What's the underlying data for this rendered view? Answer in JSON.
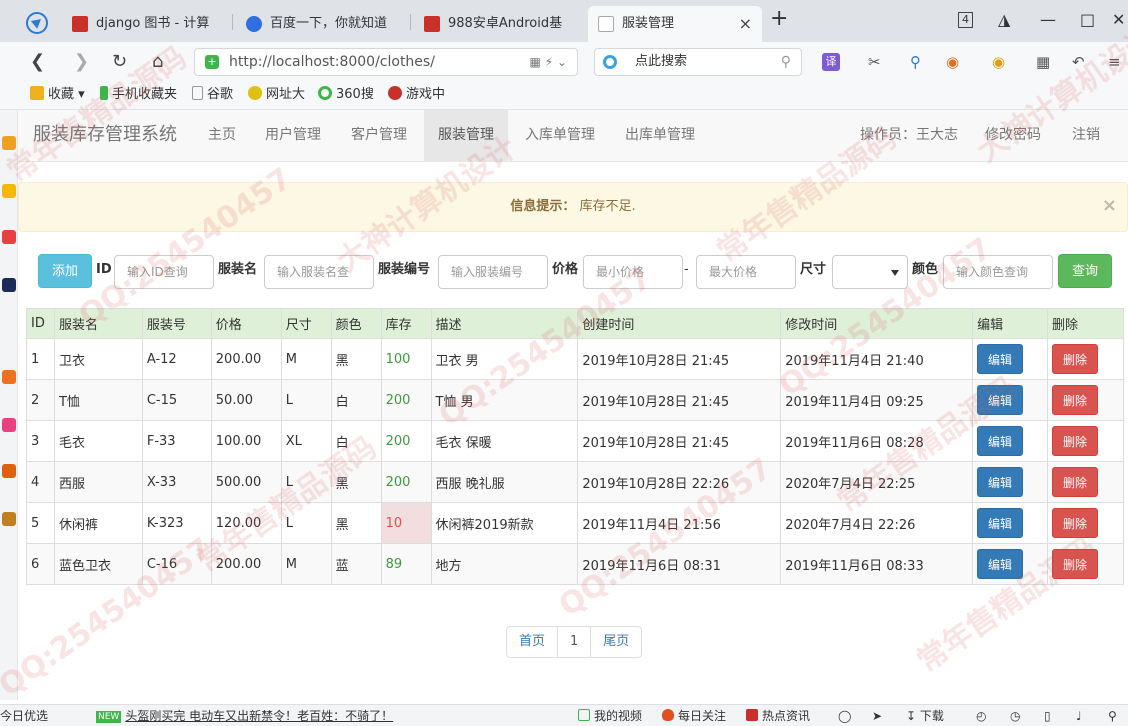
{
  "browser": {
    "tabs": [
      {
        "title": "django 图书 - 计算",
        "icon_color": "#c9302c"
      },
      {
        "title": "百度一下，你就知道",
        "icon_color": "#2f6fe0"
      },
      {
        "title": "988安卓Android基",
        "icon_color": "#c9302c"
      },
      {
        "title": "服装管理",
        "icon_color": "#dddddd",
        "close": "×"
      }
    ],
    "new_tab": "+",
    "tab_count": "4",
    "url": "http://localhost:8000/clothes/",
    "search_placeholder": "点此搜索",
    "bookmarks": [
      "收藏",
      "手机收藏夹",
      "谷歌",
      "网址大",
      "360搜",
      "游戏中"
    ]
  },
  "app": {
    "brand": "服装库存管理系统",
    "nav": [
      {
        "label": "主页",
        "active": false
      },
      {
        "label": "用户管理",
        "active": false
      },
      {
        "label": "客户管理",
        "active": false
      },
      {
        "label": "服装管理",
        "active": true
      },
      {
        "label": "入库单管理",
        "active": false
      },
      {
        "label": "出库单管理",
        "active": false
      }
    ],
    "operator": "操作员：王大志",
    "change_password": "修改密码",
    "logout": "注销"
  },
  "alert": {
    "title": "信息提示：",
    "message": "库存不足.",
    "close": "×"
  },
  "filter": {
    "add_label": "添加",
    "id_label": "ID",
    "id_placeholder": "输入ID查询",
    "name_label": "服装名",
    "name_placeholder": "输入服装名查",
    "code_label": "服装编号",
    "code_placeholder": "输入服装编号",
    "price_label": "价格",
    "min_price_placeholder": "最小价格",
    "dash": "-",
    "max_price_placeholder": "最大价格",
    "size_label": "尺寸",
    "color_label": "颜色",
    "color_placeholder": "输入颜色查询",
    "query_label": "查询"
  },
  "table": {
    "headers": [
      "ID",
      "服装名",
      "服装号",
      "价格",
      "尺寸",
      "颜色",
      "库存",
      "描述",
      "创建时间",
      "修改时间",
      "编辑",
      "删除"
    ],
    "edit_label": "编辑",
    "delete_label": "删除",
    "rows": [
      {
        "id": "1",
        "name": "卫衣",
        "code": "A-12",
        "price": "200.00",
        "size": "M",
        "color": "黑",
        "stock": "100",
        "low": false,
        "desc": "卫衣 男",
        "created": "2019年10月28日 21:45",
        "modified": "2019年11月4日 21:40"
      },
      {
        "id": "2",
        "name": "T恤",
        "code": "C-15",
        "price": "50.00",
        "size": "L",
        "color": "白",
        "stock": "200",
        "low": false,
        "desc": "T恤 男",
        "created": "2019年10月28日 21:45",
        "modified": "2019年11月4日 09:25"
      },
      {
        "id": "3",
        "name": "毛衣",
        "code": "F-33",
        "price": "100.00",
        "size": "XL",
        "color": "白",
        "stock": "200",
        "low": false,
        "desc": "毛衣 保暖",
        "created": "2019年10月28日 21:45",
        "modified": "2019年11月6日 08:28"
      },
      {
        "id": "4",
        "name": "西服",
        "code": "X-33",
        "price": "500.00",
        "size": "L",
        "color": "黑",
        "stock": "200",
        "low": false,
        "desc": "西服 晚礼服",
        "created": "2019年10月28日 22:26",
        "modified": "2020年7月4日 22:25"
      },
      {
        "id": "5",
        "name": "休闲裤",
        "code": "K-323",
        "price": "120.00",
        "size": "L",
        "color": "黑",
        "stock": "10",
        "low": true,
        "desc": "休闲裤2019新款",
        "created": "2019年11月4日 21:56",
        "modified": "2020年7月4日 22:26"
      },
      {
        "id": "6",
        "name": "蓝色卫衣",
        "code": "C-16",
        "price": "200.00",
        "size": "M",
        "color": "蓝",
        "stock": "89",
        "low": false,
        "desc": "地方",
        "created": "2019年11月6日 08:31",
        "modified": "2019年11月6日 08:33"
      }
    ]
  },
  "pager": {
    "first": "首页",
    "current": "1",
    "last": "尾页"
  },
  "statusbar": {
    "left": "今日优选",
    "new_badge": "NEW",
    "headline": "头盔刚买完 电动车又出新禁令！老百姓：不骑了！",
    "videos": "我的视频",
    "daily": "每日关注",
    "hot": "热点资讯",
    "download": "下载"
  },
  "watermark": [
    "常年售精品源码",
    "QQ:254540457",
    "大神计算机设计"
  ]
}
